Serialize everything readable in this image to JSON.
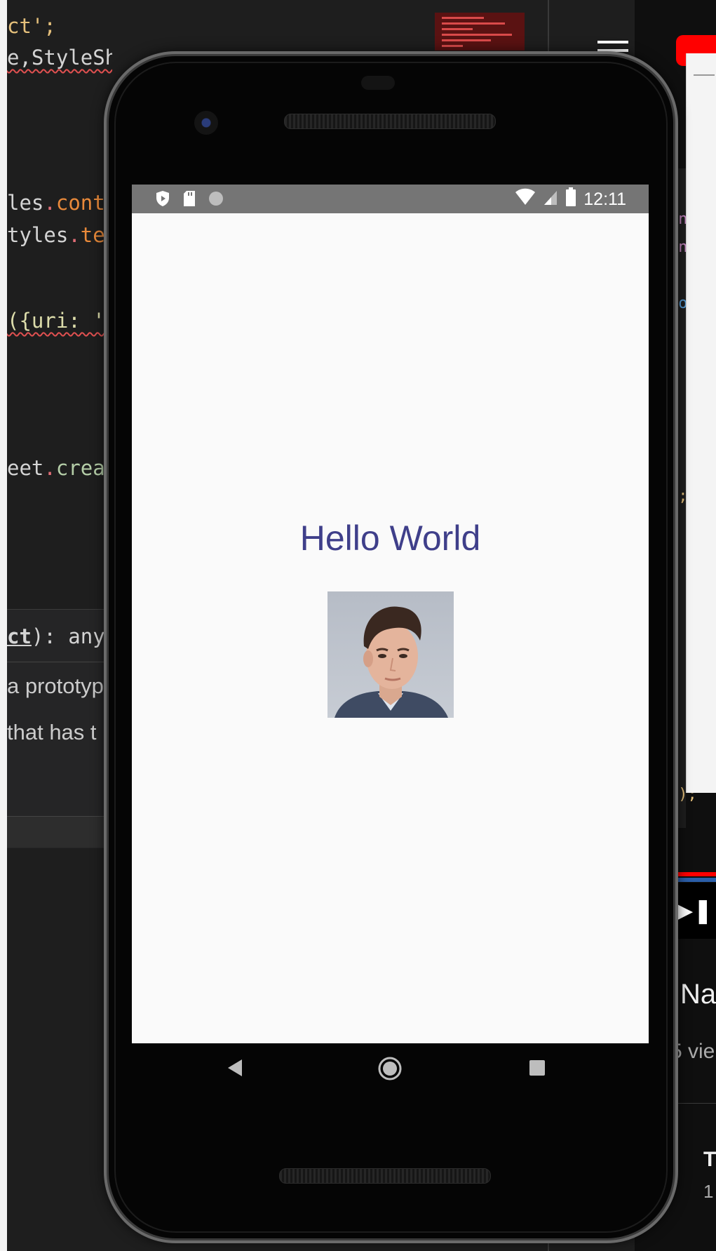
{
  "editor": {
    "lines": [
      {
        "parts": [
          {
            "t": "ct';",
            "c": "tok-y"
          }
        ]
      },
      {
        "parts": [
          {
            "t": "e,StyleShe",
            "c": ""
          }
        ],
        "squiggle": true
      },
      {
        "parts": [
          {
            "t": "les",
            "c": ""
          },
          {
            "t": ".",
            "c": "tok-r"
          },
          {
            "t": "cont",
            "c": "tok-o"
          }
        ]
      },
      {
        "parts": [
          {
            "t": "tyles",
            "c": ""
          },
          {
            "t": ".",
            "c": "tok-r"
          },
          {
            "t": "te",
            "c": "tok-o"
          }
        ]
      },
      {
        "parts": [
          {
            "t": "({uri: '",
            "c": "tok-v"
          }
        ],
        "squiggle": true
      },
      {
        "parts": [
          {
            "t": "eet",
            "c": ""
          },
          {
            "t": ".",
            "c": "tok-r"
          },
          {
            "t": "crea",
            "c": "tok-g"
          }
        ]
      }
    ],
    "signature": {
      "bold": "ct",
      "rest": "): any"
    },
    "hover_lines": [
      "a prototyp",
      " that has t"
    ]
  },
  "phone": {
    "status_time": "12:11",
    "status_icons_left": [
      "play-protect-icon",
      "sd-card-icon",
      "circle-icon"
    ],
    "status_icons_right": [
      "wifi-icon",
      "cell-signal-icon",
      "battery-icon"
    ],
    "screen_text": "Hello World",
    "avatar_desc": "profile-photo",
    "nav_buttons": [
      "back-icon",
      "home-icon",
      "recents-icon"
    ]
  },
  "youtube": {
    "title_fragment": "Na",
    "views_fragment": "5 vie",
    "channel_initial": "T",
    "channel_sub": "1"
  },
  "colors": {
    "screen_bg": "#fafafa",
    "statusbar_bg": "#757575",
    "hello_text": "#3f3f8a",
    "editor_bg": "#1e1e1e"
  }
}
